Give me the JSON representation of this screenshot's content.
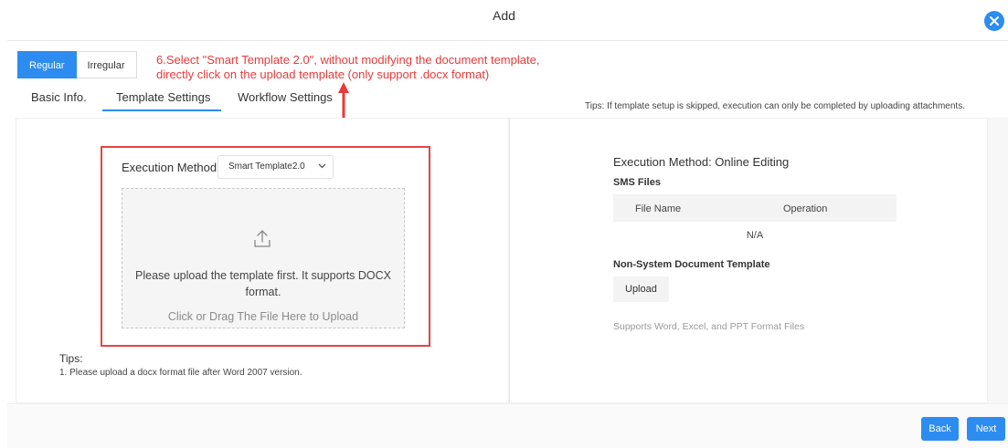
{
  "dialog": {
    "title": "Add"
  },
  "mode_toggle": {
    "regular": "Regular",
    "irregular": "Irregular"
  },
  "annotation": {
    "text": "6.Select \"Smart Template 2.0\", without modifying the document template,\ndirectly click on the upload template (only support .docx format)"
  },
  "tabs": [
    {
      "label": "Basic Info."
    },
    {
      "label": "Template Settings"
    },
    {
      "label": "Workflow Settings"
    }
  ],
  "top_tips": "Tips: If template setup is skipped, execution can only be completed by uploading attachments.",
  "left_panel": {
    "execution_label": "Execution Method:",
    "execution_value": "Smart Template2.0",
    "upload_text": "Please upload the template first. It supports DOCX format.",
    "upload_hint": "Click or Drag The File Here to Upload",
    "tips_heading": "Tips:",
    "tips_line": "1. Please upload a docx format file after Word 2007 version."
  },
  "right_panel": {
    "execution": "Execution Method: Online Editing",
    "sms_files": "SMS Files",
    "columns": [
      "File Name",
      "Operation"
    ],
    "empty": "N/A",
    "non_system": "Non-System Document Template",
    "upload_button": "Upload",
    "support": "Supports Word, Excel, and PPT Format Files"
  },
  "footer": {
    "back": "Back",
    "next": "Next"
  },
  "colors": {
    "accent": "#2d8cf0",
    "annotation": "#e83a3a"
  },
  "icons": {
    "close": "close-icon",
    "upload": "upload-icon",
    "chevron": "chevron-down-icon"
  }
}
